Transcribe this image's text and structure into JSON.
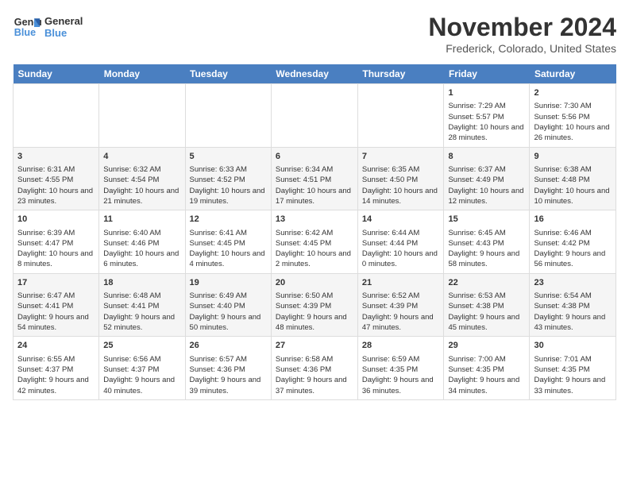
{
  "logo": {
    "line1": "General",
    "line2": "Blue"
  },
  "title": "November 2024",
  "location": "Frederick, Colorado, United States",
  "days_of_week": [
    "Sunday",
    "Monday",
    "Tuesday",
    "Wednesday",
    "Thursday",
    "Friday",
    "Saturday"
  ],
  "weeks": [
    [
      {
        "num": "",
        "info": ""
      },
      {
        "num": "",
        "info": ""
      },
      {
        "num": "",
        "info": ""
      },
      {
        "num": "",
        "info": ""
      },
      {
        "num": "",
        "info": ""
      },
      {
        "num": "1",
        "info": "Sunrise: 7:29 AM\nSunset: 5:57 PM\nDaylight: 10 hours and 28 minutes."
      },
      {
        "num": "2",
        "info": "Sunrise: 7:30 AM\nSunset: 5:56 PM\nDaylight: 10 hours and 26 minutes."
      }
    ],
    [
      {
        "num": "3",
        "info": "Sunrise: 6:31 AM\nSunset: 4:55 PM\nDaylight: 10 hours and 23 minutes."
      },
      {
        "num": "4",
        "info": "Sunrise: 6:32 AM\nSunset: 4:54 PM\nDaylight: 10 hours and 21 minutes."
      },
      {
        "num": "5",
        "info": "Sunrise: 6:33 AM\nSunset: 4:52 PM\nDaylight: 10 hours and 19 minutes."
      },
      {
        "num": "6",
        "info": "Sunrise: 6:34 AM\nSunset: 4:51 PM\nDaylight: 10 hours and 17 minutes."
      },
      {
        "num": "7",
        "info": "Sunrise: 6:35 AM\nSunset: 4:50 PM\nDaylight: 10 hours and 14 minutes."
      },
      {
        "num": "8",
        "info": "Sunrise: 6:37 AM\nSunset: 4:49 PM\nDaylight: 10 hours and 12 minutes."
      },
      {
        "num": "9",
        "info": "Sunrise: 6:38 AM\nSunset: 4:48 PM\nDaylight: 10 hours and 10 minutes."
      }
    ],
    [
      {
        "num": "10",
        "info": "Sunrise: 6:39 AM\nSunset: 4:47 PM\nDaylight: 10 hours and 8 minutes."
      },
      {
        "num": "11",
        "info": "Sunrise: 6:40 AM\nSunset: 4:46 PM\nDaylight: 10 hours and 6 minutes."
      },
      {
        "num": "12",
        "info": "Sunrise: 6:41 AM\nSunset: 4:45 PM\nDaylight: 10 hours and 4 minutes."
      },
      {
        "num": "13",
        "info": "Sunrise: 6:42 AM\nSunset: 4:45 PM\nDaylight: 10 hours and 2 minutes."
      },
      {
        "num": "14",
        "info": "Sunrise: 6:44 AM\nSunset: 4:44 PM\nDaylight: 10 hours and 0 minutes."
      },
      {
        "num": "15",
        "info": "Sunrise: 6:45 AM\nSunset: 4:43 PM\nDaylight: 9 hours and 58 minutes."
      },
      {
        "num": "16",
        "info": "Sunrise: 6:46 AM\nSunset: 4:42 PM\nDaylight: 9 hours and 56 minutes."
      }
    ],
    [
      {
        "num": "17",
        "info": "Sunrise: 6:47 AM\nSunset: 4:41 PM\nDaylight: 9 hours and 54 minutes."
      },
      {
        "num": "18",
        "info": "Sunrise: 6:48 AM\nSunset: 4:41 PM\nDaylight: 9 hours and 52 minutes."
      },
      {
        "num": "19",
        "info": "Sunrise: 6:49 AM\nSunset: 4:40 PM\nDaylight: 9 hours and 50 minutes."
      },
      {
        "num": "20",
        "info": "Sunrise: 6:50 AM\nSunset: 4:39 PM\nDaylight: 9 hours and 48 minutes."
      },
      {
        "num": "21",
        "info": "Sunrise: 6:52 AM\nSunset: 4:39 PM\nDaylight: 9 hours and 47 minutes."
      },
      {
        "num": "22",
        "info": "Sunrise: 6:53 AM\nSunset: 4:38 PM\nDaylight: 9 hours and 45 minutes."
      },
      {
        "num": "23",
        "info": "Sunrise: 6:54 AM\nSunset: 4:38 PM\nDaylight: 9 hours and 43 minutes."
      }
    ],
    [
      {
        "num": "24",
        "info": "Sunrise: 6:55 AM\nSunset: 4:37 PM\nDaylight: 9 hours and 42 minutes."
      },
      {
        "num": "25",
        "info": "Sunrise: 6:56 AM\nSunset: 4:37 PM\nDaylight: 9 hours and 40 minutes."
      },
      {
        "num": "26",
        "info": "Sunrise: 6:57 AM\nSunset: 4:36 PM\nDaylight: 9 hours and 39 minutes."
      },
      {
        "num": "27",
        "info": "Sunrise: 6:58 AM\nSunset: 4:36 PM\nDaylight: 9 hours and 37 minutes."
      },
      {
        "num": "28",
        "info": "Sunrise: 6:59 AM\nSunset: 4:35 PM\nDaylight: 9 hours and 36 minutes."
      },
      {
        "num": "29",
        "info": "Sunrise: 7:00 AM\nSunset: 4:35 PM\nDaylight: 9 hours and 34 minutes."
      },
      {
        "num": "30",
        "info": "Sunrise: 7:01 AM\nSunset: 4:35 PM\nDaylight: 9 hours and 33 minutes."
      }
    ]
  ]
}
